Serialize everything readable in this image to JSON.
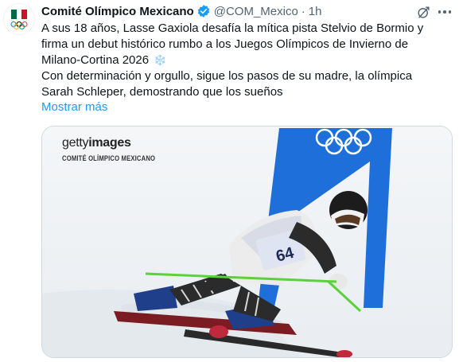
{
  "author": {
    "name": "Comité Olímpico Mexicano",
    "handle": "@COM_Mexico",
    "separator": "·",
    "time": "1h"
  },
  "tweet": {
    "lines": [
      "A sus 18 años, Lasse Gaxiola desafía la mítica pista Stelvio de Bormio  y",
      "firma un debut histórico rumbo a los Juegos Olímpicos de Invierno de",
      "Milano-Cortina 2026",
      "Con determinación y orgullo, sigue los pasos de su madre, la olímpica",
      "Sarah Schleper, demostrando que los sueños"
    ],
    "emoji": "❄️",
    "show_more": "Mostrar más"
  },
  "media": {
    "watermark_brand_light": "getty",
    "watermark_brand_bold": "images",
    "watermark_credit": "COMITÉ OLÍMPICO MEXICANO",
    "bib_number": "64"
  },
  "icons": {
    "verified": "verified-badge-icon",
    "grok": "grok-icon",
    "more": "more-icon",
    "snowflake": "snowflake-icon"
  },
  "colors": {
    "accent": "#1d9bf0",
    "text": "#0f1419",
    "secondary": "#536471",
    "flag_green": "#006847",
    "flag_red": "#ce1126"
  }
}
